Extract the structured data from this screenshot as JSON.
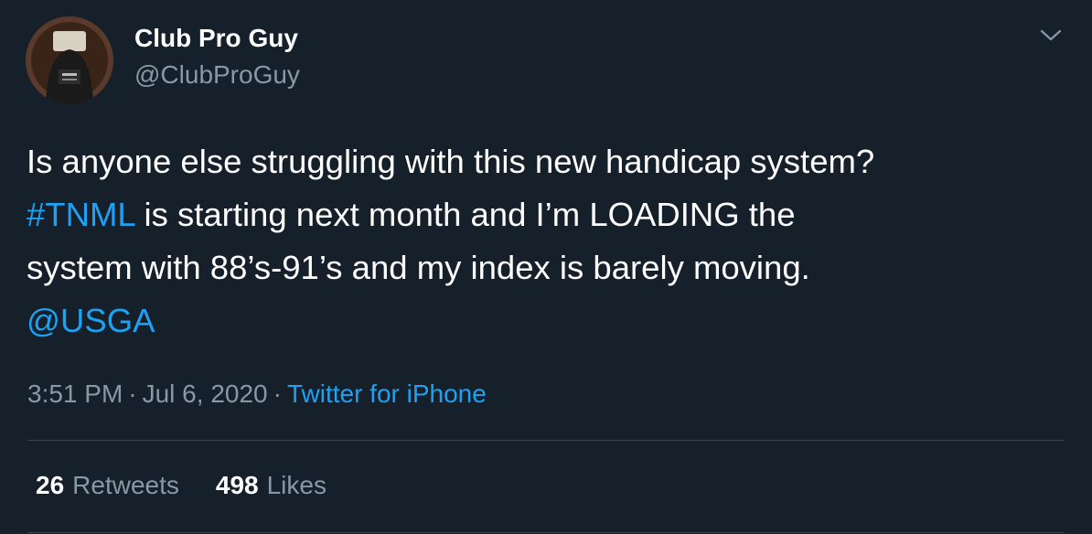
{
  "tweet": {
    "author": {
      "name": "Club Pro Guy",
      "handle": "@ClubProGuy"
    },
    "text_lines": [
      [
        {
          "text": "Is anyone else struggling with this new handicap system?",
          "type": "text"
        }
      ],
      [
        {
          "text": "#TNML",
          "type": "hashtag"
        },
        {
          "text": " is starting next month and I’m LOADING the",
          "type": "text"
        }
      ],
      [
        {
          "text": "system with 88’s-91’s and my index is barely moving.",
          "type": "text"
        }
      ],
      [
        {
          "text": "@USGA",
          "type": "mention"
        }
      ]
    ],
    "meta": {
      "time": "3:51 PM",
      "separator": "·",
      "date": "Jul 6, 2020",
      "source": "Twitter for iPhone"
    },
    "stats": {
      "retweets": {
        "count": "26",
        "label": "Retweets"
      },
      "likes": {
        "count": "498",
        "label": "Likes"
      }
    }
  },
  "colors": {
    "background": "#15202b",
    "text_primary": "#ffffff",
    "text_secondary": "#8899a6",
    "link": "#1da1f2",
    "divider": "#38444d"
  },
  "icons": {
    "menu": "chevron-down-icon"
  }
}
